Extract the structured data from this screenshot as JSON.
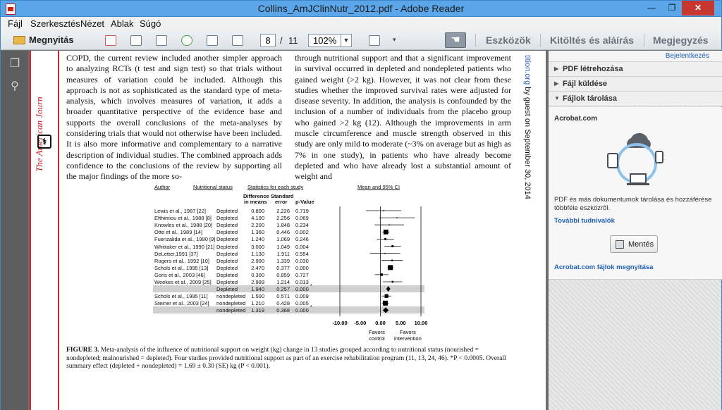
{
  "window": {
    "title": "Collins_AmJClinNutr_2012.pdf - Adobe Reader",
    "minimize_glyph": "—",
    "maximize_glyph": "❐",
    "close_glyph": "✕"
  },
  "menu": [
    "Fájl",
    "Szerkesztés",
    "Nézet",
    "Ablak",
    "Súgó"
  ],
  "toolbar": {
    "open_label": "Megnyitás",
    "page_current": "8",
    "page_separator": "/",
    "page_total": "11",
    "zoom": "102%",
    "tools": "Eszközök",
    "fill_sign": "Kitöltés és aláírás",
    "comment": "Megjegyzés"
  },
  "document": {
    "journal_vertical": "The American Journ",
    "download_vertical_link": "tition.org",
    "download_vertical_text": " by guest on September 30, 2014",
    "left_column": "COPD, the current review included another simpler approach to analyzing RCTs (t test and sign test) so that trials without measures of variation could be included. Although this approach is not as sophisticated as the standard type of meta-analysis, which involves measures of variation, it adds a broader quantitative perspective of the evidence base and supports the overall conclusions of the meta-analyses by considering trials that would not otherwise have been included. It is also more informative and complementary to a narrative description of individual studies. The combined approach adds confidence to the conclusions of the review by supporting all the major findings of the more so-",
    "right_column": "through nutritional support and that a significant improvement in survival occurred in depleted and nondepleted patients who gained weight (>2 kg). However, it was not clear from these studies whether the improved survival rates were adjusted for disease severity. In addition, the analysis is confounded by the inclusion of a number of individuals from the placebo group who gained >2 kg (12). Although the improvements in arm muscle circumference and muscle strength observed in this study are only mild to moderate (~3% on average but as high as 7% in one study), in patients who have already become depleted and who have already lost a substantial amount of weight and",
    "caption_label": "FIGURE 3.",
    "caption_text": " Meta-analysis of the influence of nutritional support on weight (kg) change in 13 studies grouped according to nutritional status (nourished = nondepleted; malnourished = depleted). Four studies provided nutritional support as part of an exercise rehabilitation program (11, 13, 24, 46). *P < 0.0005. Overall summary effect (depleted + nondepleted) = 1.69 ± 0.30 (SE) kg (P < 0.001)."
  },
  "figure": {
    "col_author": "Author",
    "col_status": "Nutritional status",
    "col_stats": "Statistics for each study",
    "col_ci": "Mean and 95% CI",
    "sub_diff_1": "Difference",
    "sub_diff_2": "in means",
    "sub_se_1": "Standard",
    "sub_se_2": "error",
    "sub_p": "p-Value",
    "rows": [
      {
        "author": "Lewis et al., 1987 [22]",
        "status": "Depleted",
        "diff": "0.800",
        "se": "2.226",
        "p": "0.719",
        "star": "",
        "summary": false
      },
      {
        "author": "Efthimiou et al., 1988 [8]",
        "status": "Depleted",
        "diff": "4.100",
        "se": "2.256",
        "p": "0.069",
        "star": "",
        "summary": false
      },
      {
        "author": "Knowles et al., 1988 [20]",
        "status": "Depleted",
        "diff": "2.200",
        "se": "1.848",
        "p": "0.234",
        "star": "",
        "summary": false
      },
      {
        "author": "Otte et al., 1989 [14]",
        "status": "Depleted",
        "diff": "1.360",
        "se": "0.446",
        "p": "0.002",
        "star": "",
        "summary": false
      },
      {
        "author": "Fuenzalida et al., 1990 [9]",
        "status": "Depleted",
        "diff": "1.240",
        "se": "1.069",
        "p": "0.246",
        "star": "",
        "summary": false
      },
      {
        "author": "Whittaker et al., 1990 [21]",
        "status": "Depleted",
        "diff": "3.000",
        "se": "1.049",
        "p": "0.004",
        "star": "",
        "summary": false
      },
      {
        "author": "DeLetter,1991 [37]",
        "status": "Depleted",
        "diff": "1.130",
        "se": "1.911",
        "p": "0.554",
        "star": "",
        "summary": false
      },
      {
        "author": "Rogers et al., 1992 [10]",
        "status": "Depleted",
        "diff": "2.900",
        "se": "1.339",
        "p": "0.030",
        "star": "",
        "summary": false
      },
      {
        "author": "Schols et al., 1995 [13]",
        "status": "Depleted",
        "diff": "2.470",
        "se": "0.377",
        "p": "0.000",
        "star": "",
        "summary": false
      },
      {
        "author": "Goris et al., 2003 [46]",
        "status": "Depleted",
        "diff": "0.300",
        "se": "0.859",
        "p": "0.727",
        "star": "",
        "summary": false
      },
      {
        "author": "Weekes et al., 2009 [25]",
        "status": "Depleted",
        "diff": "2.999",
        "se": "1.214",
        "p": "0.013",
        "star": "",
        "summary": false
      },
      {
        "author": "",
        "status": "Depleted",
        "diff": "1.940",
        "se": "0.257",
        "p": "0.000",
        "star": "*",
        "summary": true
      },
      {
        "author": "Schols et al., 1995 [11]",
        "status": "nondepleted",
        "diff": "1.500",
        "se": "0.571",
        "p": "0.009",
        "star": "",
        "summary": false
      },
      {
        "author": "Steiner et al., 2003 [24]",
        "status": "nondepleted",
        "diff": "1.210",
        "se": "0.428",
        "p": "0.005",
        "star": "",
        "summary": false
      },
      {
        "author": "",
        "status": "nondepleted",
        "diff": "1.319",
        "se": "0.368",
        "p": "0.000",
        "star": "*",
        "summary": true
      }
    ],
    "axis_ticks": [
      "-10.00",
      "-5.00",
      "0.00",
      "5.00",
      "10.00"
    ],
    "favors_left_1": "Favors",
    "favors_left_2": "control",
    "favors_right_1": "Favors",
    "favors_right_2": "intervention"
  },
  "right_panel": {
    "sign_in": "Bejelentkezés",
    "sections": [
      {
        "label": "PDF létrehozása",
        "arrow": "▶"
      },
      {
        "label": "Fájl küldése",
        "arrow": "▶"
      },
      {
        "label": "Fájlok tárolása",
        "arrow": "▼"
      }
    ],
    "heading": "Acrobat.com",
    "description": "PDF és más dokumentumok tárolása és hozzáférése többféle eszközről.",
    "more_info": "További tudnivalók",
    "save_button": "Mentés",
    "open_files_link": "Acrobat.com fájlok megnyitása"
  },
  "colors": {
    "titlebar": "#5ba6e8",
    "close": "#c7372f",
    "journal_red": "#c21f26",
    "link_blue": "#1d5fb8"
  }
}
